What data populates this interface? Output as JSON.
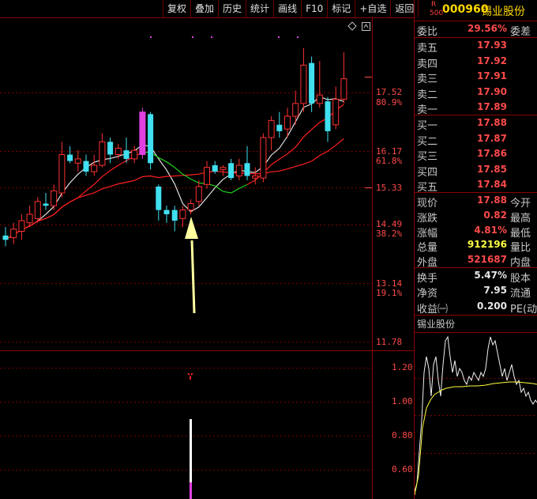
{
  "toolbar": {
    "buttons": [
      "复权",
      "叠加",
      "历史",
      "统计",
      "画线",
      "F10",
      "标记",
      "+自选",
      "返回"
    ]
  },
  "price_axis": {
    "labels": [
      {
        "price": "17.52",
        "pct": "80.9%"
      },
      {
        "price": "16.17",
        "pct": "61.8%"
      },
      {
        "price": "15.33",
        "pct": ""
      },
      {
        "price": "14.49",
        "pct": "38.2%"
      },
      {
        "price": "13.14",
        "pct": "19.1%"
      },
      {
        "price": "11.78",
        "pct": ""
      }
    ]
  },
  "osc_axis": {
    "labels": [
      "1.20",
      "1.00",
      "0.80",
      "0.60"
    ]
  },
  "stock": {
    "r_mark": "R",
    "r_sub": "500",
    "code": "000960",
    "name": "锡业股份"
  },
  "quote": {
    "webi": {
      "label": "委比",
      "value": "29.56%",
      "tail": "委差"
    },
    "sell": [
      {
        "label": "卖五",
        "value": "17.93"
      },
      {
        "label": "卖四",
        "value": "17.92"
      },
      {
        "label": "卖三",
        "value": "17.91"
      },
      {
        "label": "卖二",
        "value": "17.90"
      },
      {
        "label": "卖一",
        "value": "17.89"
      }
    ],
    "buy": [
      {
        "label": "买一",
        "value": "17.88"
      },
      {
        "label": "买二",
        "value": "17.87"
      },
      {
        "label": "买三",
        "value": "17.86"
      },
      {
        "label": "买四",
        "value": "17.85"
      },
      {
        "label": "买五",
        "value": "17.84"
      }
    ],
    "stats": [
      {
        "label": "现价",
        "value": "17.88",
        "tail": "今开",
        "color": "red"
      },
      {
        "label": "涨跌",
        "value": "0.82",
        "tail": "最高",
        "color": "red"
      },
      {
        "label": "涨幅",
        "value": "4.81%",
        "tail": "最低",
        "color": "red"
      },
      {
        "label": "总量",
        "value": "912196",
        "tail": "量比",
        "color": "yellow"
      },
      {
        "label": "外盘",
        "value": "521687",
        "tail": "内盘",
        "color": "red"
      }
    ],
    "stats2": [
      {
        "label": "换手",
        "value": "5.47%",
        "tail": "股本",
        "color": "white"
      },
      {
        "label": "净资",
        "value": "7.95",
        "tail": "流通",
        "color": "white"
      },
      {
        "label": "收益㈠",
        "value": "0.200",
        "tail": "PE(动",
        "color": "white"
      }
    ]
  },
  "mini_chart": {
    "title": "锡业股份"
  },
  "colors": {
    "up": "#ff3030",
    "down": "#40e0f0",
    "ma_red": "#ff2020",
    "ma_green": "#20d020",
    "ma_white": "#e0e0e0",
    "magenta": "#e040e0",
    "arrow": "#ffffa0",
    "frame": "#8b0000"
  },
  "chart_data": {
    "type": "candlestick",
    "ylim": [
      11.78,
      17.9
    ],
    "candles": [
      {
        "o": 14.2,
        "h": 14.4,
        "l": 13.95,
        "c": 14.1
      },
      {
        "o": 14.15,
        "h": 14.5,
        "l": 14.0,
        "c": 14.35
      },
      {
        "o": 14.3,
        "h": 14.7,
        "l": 14.1,
        "c": 14.55
      },
      {
        "o": 14.5,
        "h": 14.9,
        "l": 14.4,
        "c": 14.7
      },
      {
        "o": 14.6,
        "h": 15.1,
        "l": 14.5,
        "c": 15.0
      },
      {
        "o": 14.95,
        "h": 15.2,
        "l": 14.8,
        "c": 14.9
      },
      {
        "o": 14.9,
        "h": 15.4,
        "l": 14.8,
        "c": 15.25
      },
      {
        "o": 15.2,
        "h": 16.4,
        "l": 15.1,
        "c": 16.1
      },
      {
        "o": 16.1,
        "h": 16.3,
        "l": 15.9,
        "c": 15.95
      },
      {
        "o": 15.9,
        "h": 16.2,
        "l": 15.7,
        "c": 16.0
      },
      {
        "o": 15.95,
        "h": 16.1,
        "l": 15.6,
        "c": 15.7
      },
      {
        "o": 15.7,
        "h": 16.1,
        "l": 15.6,
        "c": 15.85
      },
      {
        "o": 15.85,
        "h": 16.6,
        "l": 15.8,
        "c": 16.4
      },
      {
        "o": 16.4,
        "h": 16.5,
        "l": 15.9,
        "c": 16.1
      },
      {
        "o": 16.1,
        "h": 16.35,
        "l": 16.0,
        "c": 16.25
      },
      {
        "o": 16.2,
        "h": 16.5,
        "l": 15.9,
        "c": 16.0
      },
      {
        "o": 16.0,
        "h": 16.3,
        "l": 15.9,
        "c": 16.2
      },
      {
        "o": 16.1,
        "h": 17.2,
        "l": 16.0,
        "c": 17.1
      },
      {
        "o": 17.05,
        "h": 17.1,
        "l": 15.75,
        "c": 15.9
      },
      {
        "o": 15.35,
        "h": 15.4,
        "l": 14.55,
        "c": 14.8
      },
      {
        "o": 14.8,
        "h": 14.9,
        "l": 14.5,
        "c": 14.7
      },
      {
        "o": 14.8,
        "h": 14.9,
        "l": 14.3,
        "c": 14.55
      },
      {
        "o": 14.6,
        "h": 14.9,
        "l": 14.4,
        "c": 14.8
      },
      {
        "o": 14.8,
        "h": 15.05,
        "l": 14.7,
        "c": 14.95
      },
      {
        "o": 15.0,
        "h": 15.5,
        "l": 14.9,
        "c": 15.35
      },
      {
        "o": 15.4,
        "h": 15.95,
        "l": 15.3,
        "c": 15.8
      },
      {
        "o": 15.85,
        "h": 15.95,
        "l": 15.65,
        "c": 15.7
      },
      {
        "o": 15.75,
        "h": 15.85,
        "l": 15.6,
        "c": 15.8
      },
      {
        "o": 15.9,
        "h": 16.0,
        "l": 15.5,
        "c": 15.55
      },
      {
        "o": 15.6,
        "h": 16.0,
        "l": 15.5,
        "c": 15.85
      },
      {
        "o": 15.9,
        "h": 16.3,
        "l": 15.5,
        "c": 15.6
      },
      {
        "o": 15.55,
        "h": 15.8,
        "l": 15.4,
        "c": 15.6
      },
      {
        "o": 15.55,
        "h": 16.6,
        "l": 15.45,
        "c": 16.5
      },
      {
        "o": 16.5,
        "h": 17.0,
        "l": 16.2,
        "c": 16.9
      },
      {
        "o": 16.8,
        "h": 17.1,
        "l": 16.5,
        "c": 16.65
      },
      {
        "o": 16.7,
        "h": 17.2,
        "l": 16.5,
        "c": 17.0
      },
      {
        "o": 17.0,
        "h": 17.6,
        "l": 16.8,
        "c": 17.3
      },
      {
        "o": 17.3,
        "h": 18.6,
        "l": 17.1,
        "c": 18.2
      },
      {
        "o": 18.25,
        "h": 18.4,
        "l": 17.1,
        "c": 17.3
      },
      {
        "o": 17.3,
        "h": 18.3,
        "l": 17.2,
        "c": 17.5
      },
      {
        "o": 17.35,
        "h": 17.45,
        "l": 16.4,
        "c": 16.65
      },
      {
        "o": 16.8,
        "h": 17.7,
        "l": 16.7,
        "c": 17.4
      },
      {
        "o": 17.4,
        "h": 18.5,
        "l": 17.3,
        "c": 17.88
      }
    ]
  }
}
